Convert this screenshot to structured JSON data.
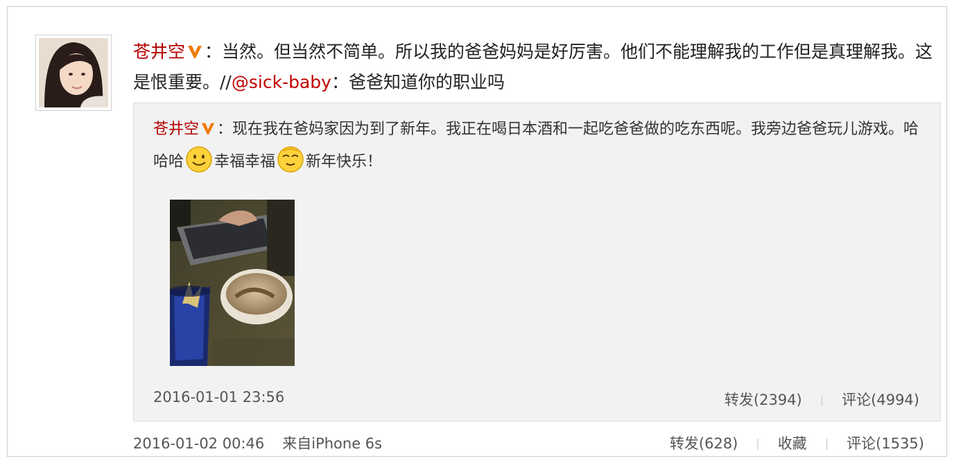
{
  "post": {
    "author": "苍井空",
    "colon": "：",
    "text": "当然。但当然不简单。所以我的爸爸妈妈是好厉害。他们不能理解我的工作但是真理解我。这是恨重要。//",
    "mention": "@sick-baby",
    "mention_text": "：爸爸知道你的职业吗",
    "time": "2016-01-02 00:46",
    "source": "来自iPhone 6s",
    "actions": {
      "repost": "转发(628)",
      "favorite": "收藏",
      "comment": "评论(1535)"
    },
    "separator": "|"
  },
  "quoted": {
    "author": "苍井空",
    "colon": "：",
    "text_1": "现在我在爸妈家因为到了新年。我正在喝日本酒和一起吃爸爸做的吃东西呢。我旁边爸爸玩儿游戏。哈哈哈",
    "text_2": "幸福幸福",
    "text_3": "新年快乐！",
    "time": "2016-01-01 23:56",
    "actions": {
      "repost": "转发(2394)",
      "comment": "评论(4994)"
    },
    "separator": "|"
  },
  "colors": {
    "name": "#b30000",
    "mention": "#c00000",
    "verified_badge": "#f07c00",
    "quote_bg": "#f2f2f2"
  },
  "icons": [
    "verified-v-icon",
    "smile-emoji-icon",
    "content-emoji-icon"
  ]
}
